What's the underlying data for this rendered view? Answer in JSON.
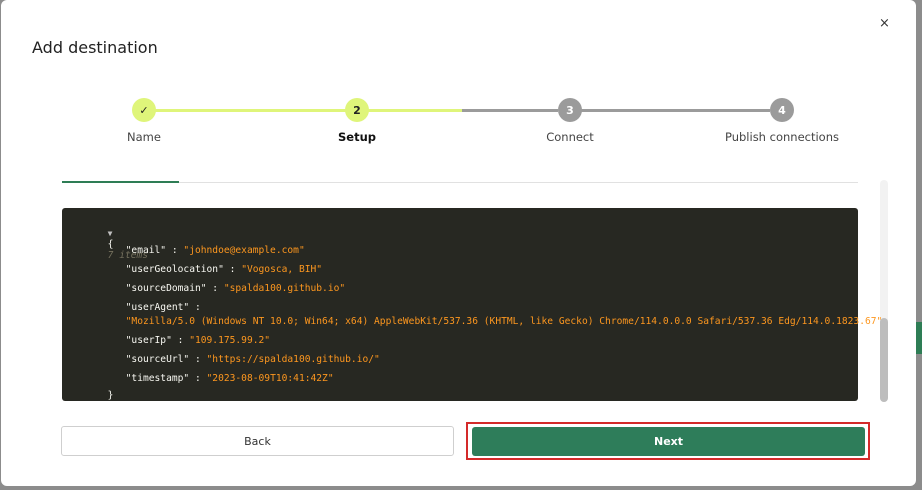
{
  "modal": {
    "title": "Add destination",
    "close_glyph": "×"
  },
  "stepper": {
    "steps": [
      {
        "label": "Name",
        "badge": "✓",
        "state": "done"
      },
      {
        "label": "Setup",
        "badge": "2",
        "state": "active"
      },
      {
        "label": "Connect",
        "badge": "3",
        "state": "todo"
      },
      {
        "label": "Publish connections",
        "badge": "4",
        "state": "todo"
      }
    ]
  },
  "json_viewer": {
    "open_brace": "{",
    "close_brace": "}",
    "meta": "7 items",
    "fields": [
      {
        "key": "\"email\"",
        "value": "\"johndoe@example.com\""
      },
      {
        "key": "\"userGeolocation\"",
        "value": "\"Vogosca, BIH\""
      },
      {
        "key": "\"sourceDomain\"",
        "value": "\"spalda100.github.io\""
      },
      {
        "key": "\"userAgent\"",
        "value": "\"Mozilla/5.0 (Windows NT 10.0; Win64; x64) AppleWebKit/537.36 (KHTML, like Gecko) Chrome/114.0.0.0 Safari/537.36 Edg/114.0.1823.67\""
      },
      {
        "key": "\"userIp\"",
        "value": "\"109.175.99.2\""
      },
      {
        "key": "\"sourceUrl\"",
        "value": "\"https://spalda100.github.io/\""
      },
      {
        "key": "\"timestamp\"",
        "value": "\"2023-08-09T10:41:42Z\""
      }
    ]
  },
  "buttons": {
    "back_label": "Back",
    "next_label": "Next"
  },
  "colors": {
    "accent_green": "#2e7d5a",
    "step_done": "#dff57a",
    "step_todo": "#9b9b9b",
    "highlight": "#d42a2a"
  }
}
